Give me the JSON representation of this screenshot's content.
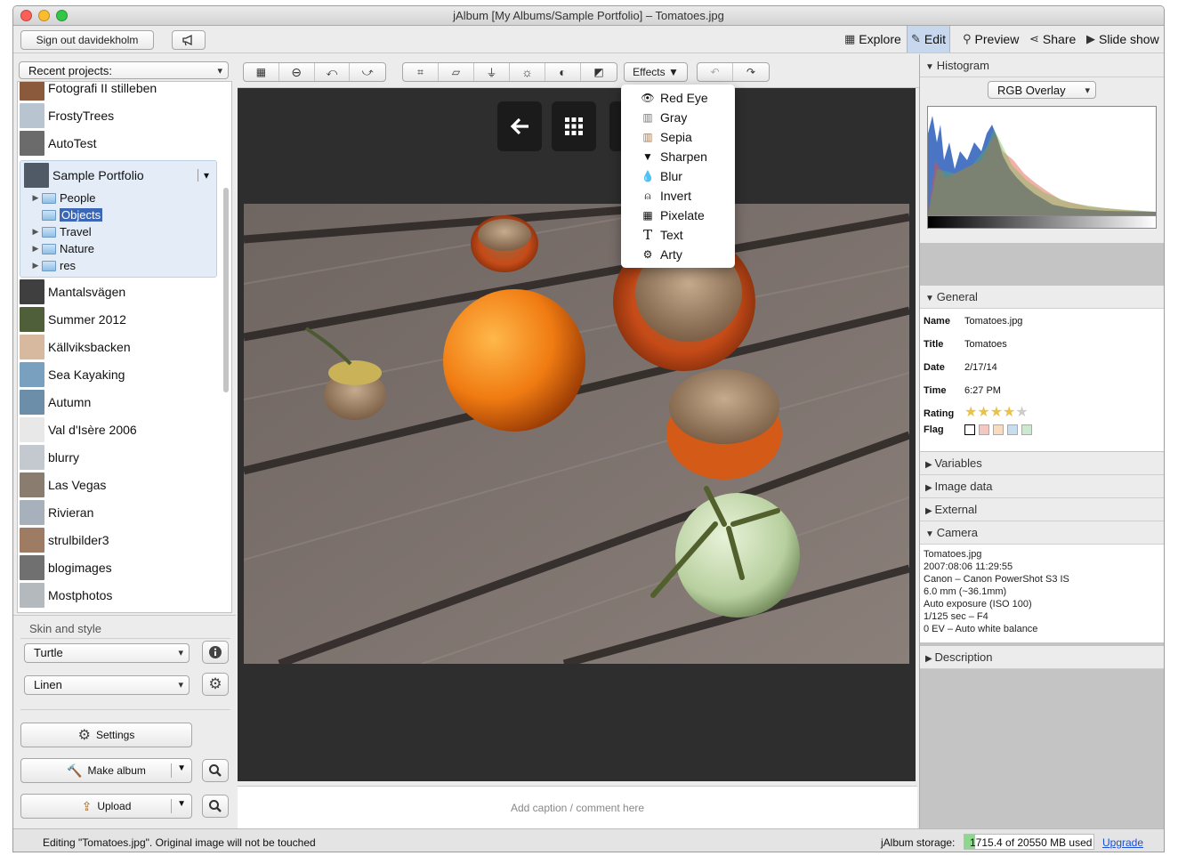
{
  "window": {
    "title": "jAlbum [My Albums/Sample Portfolio] – Tomatoes.jpg"
  },
  "topbar": {
    "sign_out": "Sign out davidekholm",
    "nav": [
      {
        "label": "Explore",
        "icon": "grid-icon"
      },
      {
        "label": "Edit",
        "icon": "pencil-icon",
        "active": true
      },
      {
        "label": "Preview",
        "icon": "magnifier-icon"
      },
      {
        "label": "Share",
        "icon": "share-icon"
      },
      {
        "label": "Slide show",
        "icon": "play-icon"
      }
    ]
  },
  "sidebar": {
    "recent_label": "Recent projects:",
    "projects_top": [
      "Fotografi II stilleben",
      "FrostyTrees",
      "AutoTest"
    ],
    "current": {
      "name": "Sample Portfolio",
      "folders": [
        {
          "name": "People",
          "expandable": true
        },
        {
          "name": "Objects",
          "selected": true,
          "expandable": false
        },
        {
          "name": "Travel",
          "expandable": true
        },
        {
          "name": "Nature",
          "expandable": true
        },
        {
          "name": "res",
          "expandable": true
        }
      ]
    },
    "projects_bottom": [
      "Mantalsvägen",
      "Summer 2012",
      "Källviksbacken",
      "Sea Kayaking",
      "Autumn",
      "Val d'Isère 2006",
      "blurry",
      "Las Vegas",
      "Rivieran",
      "strulbilder3",
      "blogimages",
      "Mostphotos"
    ],
    "skin_label": "Skin and style",
    "skin": "Turtle",
    "style": "Linen",
    "settings": "Settings",
    "make_album": "Make album",
    "upload": "Upload"
  },
  "editor": {
    "effects_label": "Effects ▼",
    "caption_placeholder": "Add caption / comment here",
    "effects": [
      {
        "label": "Red Eye",
        "icon": "eye-icon"
      },
      {
        "label": "Gray",
        "icon": "gray-swatch-icon"
      },
      {
        "label": "Sepia",
        "icon": "sepia-swatch-icon"
      },
      {
        "label": "Sharpen",
        "icon": "sharpen-icon"
      },
      {
        "label": "Blur",
        "icon": "drop-icon"
      },
      {
        "label": "Invert",
        "icon": "invert-icon"
      },
      {
        "label": "Pixelate",
        "icon": "pixelate-icon"
      },
      {
        "label": "Text",
        "icon": "text-icon"
      },
      {
        "label": "Arty",
        "icon": "gear-icon"
      }
    ]
  },
  "inspector": {
    "histogram_label": "Histogram",
    "histogram_mode": "RGB Overlay",
    "general_label": "General",
    "general": [
      {
        "key": "Name",
        "value": "Tomatoes.jpg"
      },
      {
        "key": "Title",
        "value": "Tomatoes"
      },
      {
        "key": "Date",
        "value": "2/17/14"
      },
      {
        "key": "Time",
        "value": "6:27 PM"
      }
    ],
    "rating_label": "Rating",
    "rating": 4,
    "rating_max": 5,
    "flag_label": "Flag",
    "flag_colors": [
      "#ffffff",
      "#f5c7c1",
      "#f9dcc0",
      "#c9ddf1",
      "#cde8d0"
    ],
    "collapsed": [
      "Variables",
      "Image data",
      "External"
    ],
    "camera_label": "Camera",
    "camera": [
      "Tomatoes.jpg",
      "2007:08:06 11:29:55",
      "Canon – Canon PowerShot S3 IS",
      "6.0 mm (~36.1mm)",
      "Auto exposure (ISO 100)",
      "1/125 sec – F4",
      "0 EV – Auto white balance"
    ],
    "description_label": "Description"
  },
  "status": {
    "message": "Editing \"Tomatoes.jpg\". Original image will not be touched",
    "storage_label": "jAlbum storage:",
    "storage_used": "1715.4 of 20550 MB used",
    "storage_fraction": 0.083,
    "upgrade": "Upgrade"
  }
}
